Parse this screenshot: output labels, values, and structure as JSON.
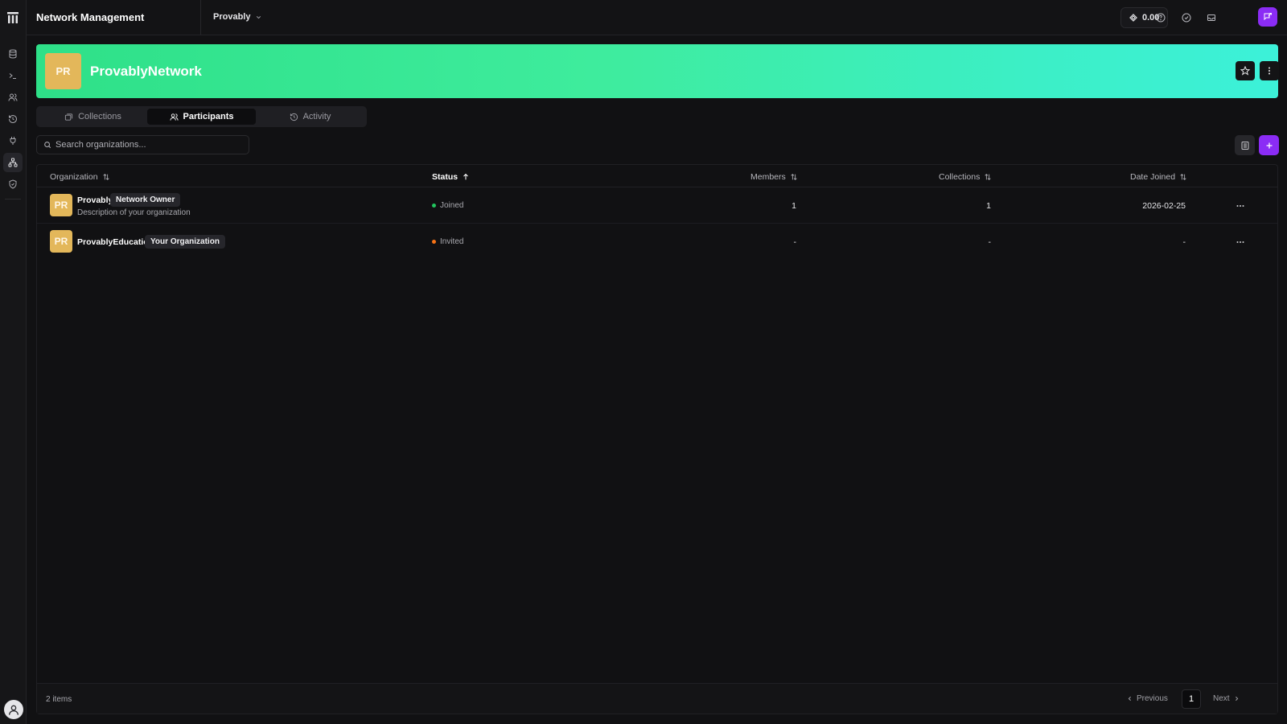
{
  "app": {
    "title": "Network Management"
  },
  "header": {
    "org_switcher": "Provably",
    "credits": "0.00"
  },
  "sidebar": {
    "items": [
      {
        "icon": "database-icon"
      },
      {
        "icon": "terminal-icon"
      },
      {
        "icon": "users-icon"
      },
      {
        "icon": "history-icon"
      },
      {
        "icon": "plug-icon"
      },
      {
        "icon": "network-icon",
        "active": true
      },
      {
        "icon": "shield-icon"
      }
    ]
  },
  "banner": {
    "avatar": "PR",
    "title": "ProvablyNetwork"
  },
  "tabs": {
    "collections": "Collections",
    "participants": "Participants",
    "activity": "Activity"
  },
  "search": {
    "placeholder": "Search organizations..."
  },
  "table": {
    "columns": {
      "organization": "Organization",
      "status": "Status",
      "members": "Members",
      "collections": "Collections",
      "date_joined": "Date Joined"
    },
    "rows": [
      {
        "avatar": "PR",
        "name": "Provably",
        "tag": "Network Owner",
        "description": "Description of your organization",
        "status": "Joined",
        "status_color": "#22c55e",
        "members": "1",
        "collections": "1",
        "date_joined": "2026-02-25"
      },
      {
        "avatar": "PR",
        "name": "ProvablyEducation",
        "tag": "Your Organization",
        "description": "",
        "status": "Invited",
        "status_color": "#f97316",
        "members": "-",
        "collections": "-",
        "date_joined": "-"
      }
    ]
  },
  "footer": {
    "count": "2 items",
    "previous": "Previous",
    "page": "1",
    "next": "Next"
  },
  "colors": {
    "accent": "#8b2cf5",
    "avatar": "#e3b75a",
    "banner_start": "#2ee088",
    "banner_end": "#3cf1d9"
  }
}
